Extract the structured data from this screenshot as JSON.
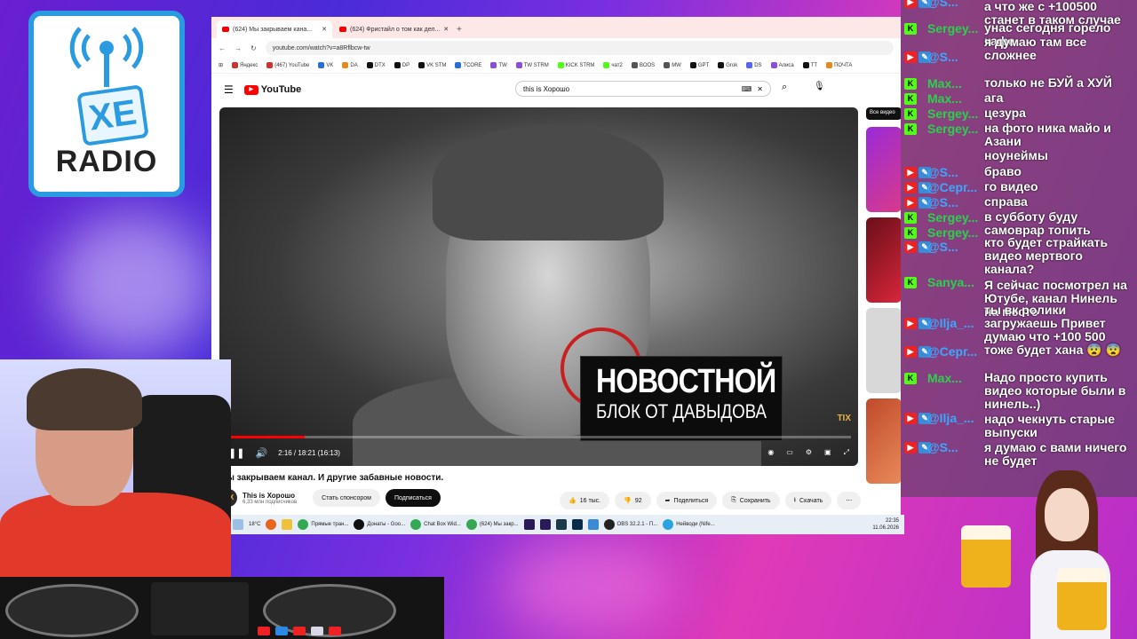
{
  "logo": {
    "letters": "XE",
    "word": "RADIO"
  },
  "browser": {
    "tabs": [
      {
        "label": "(624) Мы закрываем кана...",
        "active": true
      },
      {
        "label": "(624) Фристайл о том как дел...",
        "active": false
      }
    ],
    "url": "youtube.com/watch?v=a8Rflbcw-tw",
    "bookmarks": [
      "Яндекс",
      "(467) YouTube",
      "VK",
      "DA",
      "DTX",
      "DP",
      "VK STM",
      "TCORE",
      "TW",
      "TW STRM",
      "KICK STRM",
      "чат2",
      "BOOS",
      "MW",
      "GPT",
      "Grok",
      "DS",
      "Алиса",
      "TT",
      "ПОЧТА"
    ]
  },
  "youtube": {
    "logo_text": "YouTube",
    "search_value": "this is Хорошо",
    "video": {
      "overlay_line1": "НОВОСТНОЙ",
      "overlay_line2": "БЛОК ОТ ДАВЫДОВА",
      "time": "2:16 / 18:21 (16:13)",
      "progress": 0.125,
      "watermark": "TIX"
    },
    "title": "Мы закрываем канал. И другие забавные новости.",
    "channel": {
      "name": "This is Хорошо",
      "subscribers": "6,33 млн подписчиков",
      "avatar_text": "TIX"
    },
    "buttons": {
      "sponsor": "Стать спонсором",
      "subscribe": "Подписаться",
      "likes": "16 тыс.",
      "dislikes": "92",
      "share": "Поделиться",
      "save": "Сохранить",
      "download": "Скачать"
    },
    "sidebar_label": "Все видео"
  },
  "taskbar": {
    "items": [
      "Прямые тран...",
      "Донаты - Goo...",
      "Chat Box Wid...",
      "(624) Мы закр...",
      "OBS 32.2.1 - П...",
      "Нейводи (Nife..."
    ],
    "weather": "18°C",
    "time": "22:35",
    "date": "11.06.2026"
  },
  "chat": {
    "messages": [
      {
        "user": "@S...",
        "platform": "yt",
        "text": "а что же с +100500 станет в таком случае"
      },
      {
        "user": "Sergey...",
        "platform": "kick",
        "text": "унас сегодня горело кафе"
      },
      {
        "user": "@S...",
        "platform": "yt",
        "text": "я думаю там все сложнее"
      },
      {
        "user": "Max...",
        "platform": "kick",
        "text": "только не БУЙ а ХУЙ"
      },
      {
        "user": "Max...",
        "platform": "kick",
        "text": "ага"
      },
      {
        "user": "Sergey...",
        "platform": "kick",
        "text": "цезура"
      },
      {
        "user": "Sergey...",
        "platform": "kick",
        "text": "на фото ника майо и Азани"
      },
      {
        "user": "@S...",
        "platform": "yt",
        "text": "ноунеймы"
      },
      {
        "user": "@Серг...",
        "platform": "yt",
        "text": "браво"
      },
      {
        "user": "@S...",
        "platform": "yt",
        "text": "го видео"
      },
      {
        "user": "Sergey...",
        "platform": "kick",
        "text": "справа"
      },
      {
        "user": "Sergey...",
        "platform": "kick",
        "text": "в субботу буду самоврар топить"
      },
      {
        "user": "@S...",
        "platform": "yt",
        "text": "кто будет страйкать видео мертвого канала?"
      },
      {
        "user": "Sanya...",
        "platform": "kick",
        "text": "Я сейчас посмотрел на Ютубе, канал Нинель на месте"
      },
      {
        "user": "@Ilja_...",
        "platform": "yt",
        "text": "ты вк ролики загружаешь Привет"
      },
      {
        "user": "@Серг...",
        "platform": "yt",
        "text": "думаю что +100 500 тоже будет хана 😨 😨"
      },
      {
        "user": "Max...",
        "platform": "kick",
        "text": "Надо просто купить видео которые были в нинель..)"
      },
      {
        "user": "@Ilja_...",
        "platform": "yt",
        "text": "надо чекнуть старые выпуски"
      },
      {
        "user": "@S...",
        "platform": "yt",
        "text": "я думаю с вами ничего не будет"
      }
    ]
  }
}
